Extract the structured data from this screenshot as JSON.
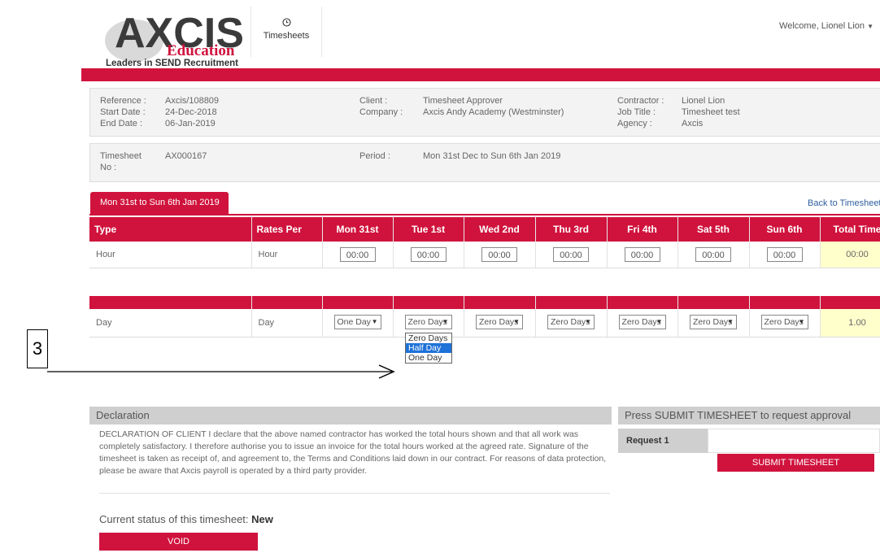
{
  "header": {
    "logo_main": "AXCIS",
    "logo_sub": "Education",
    "logo_tagline": "Leaders in SEND Recruitment",
    "nav_timesheets": "Timesheets",
    "welcome": "Welcome, Lionel Lion"
  },
  "info": {
    "reference_label": "Reference :",
    "reference": "Axcis/108809",
    "start_label": "Start Date :",
    "start": "24-Dec-2018",
    "end_label": "End Date :",
    "end": "06-Jan-2019",
    "client_label": "Client :",
    "client": "Timesheet Approver",
    "company_label": "Company :",
    "company": "Axcis Andy Academy (Westminster)",
    "contractor_label": "Contractor :",
    "contractor": "Lionel Lion",
    "jobtitle_label": "Job Title :",
    "jobtitle": "Timesheet test",
    "agency_label": "Agency :",
    "agency": "Axcis",
    "tsno_label_1": "Timesheet",
    "tsno_label_2": "No :",
    "tsno": "AX000167",
    "period_label": "Period :",
    "period": "Mon 31st Dec to Sun 6th Jan 2019"
  },
  "tab_label": "Mon 31st to Sun 6th Jan 2019",
  "back_link": "Back to Timesheets",
  "table": {
    "headers": [
      "Type",
      "Rates Per",
      "Mon 31st",
      "Tue 1st",
      "Wed 2nd",
      "Thu 3rd",
      "Fri 4th",
      "Sat 5th",
      "Sun 6th",
      "Total Time"
    ],
    "hour_row": {
      "type": "Hour",
      "rate": "Hour",
      "values": [
        "00:00",
        "00:00",
        "00:00",
        "00:00",
        "00:00",
        "00:00",
        "00:00"
      ],
      "total": "00:00"
    },
    "day_row": {
      "type": "Day",
      "rate": "Day",
      "values": [
        "One Day",
        "Zero Days",
        "Zero Days",
        "Zero Days",
        "Zero Days",
        "Zero Days",
        "Zero Days"
      ],
      "total": "1.00"
    }
  },
  "dropdown_options": [
    "Zero Days",
    "Half Day",
    "One Day"
  ],
  "dropdown_highlighted": "Half Day",
  "callout_number": "3",
  "declaration": {
    "title": "Declaration",
    "text": "DECLARATION OF CLIENT I declare that the above named contractor has worked the total hours shown and that all work was completely satisfactory. I therefore authorise you to issue an invoice for the total hours worked at the agreed rate. Signature of the timesheet is taken as receipt of, and agreement to, the Terms and Conditions laid down in our contract. For reasons of data protection, please be aware that Axcis payroll is operated by a third party provider.",
    "status_prefix": "Current status of this timesheet:",
    "status_value": "New",
    "void_label": "VOID"
  },
  "submit": {
    "title": "Press SUBMIT TIMESHEET to request approval",
    "request_label": "Request 1",
    "button_label": "SUBMIT TIMESHEET"
  },
  "colors": {
    "brand_red": "#d0133d",
    "total_cell": "#ffffcc",
    "highlight": "#1e72d8"
  }
}
